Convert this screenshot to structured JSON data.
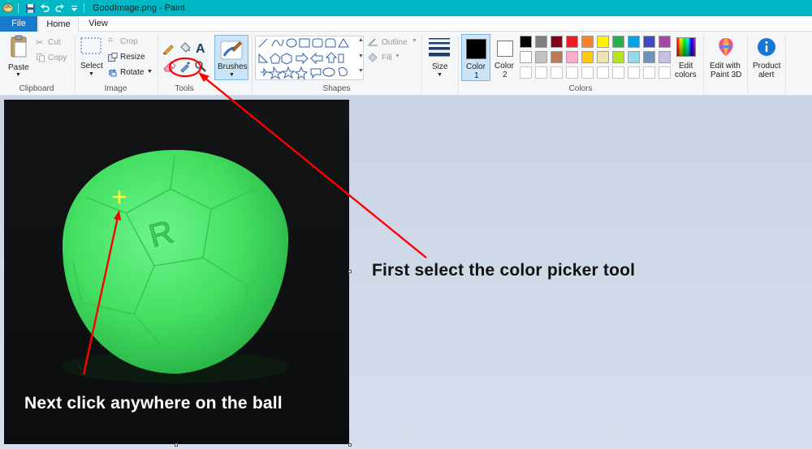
{
  "window": {
    "title": "GoodImage.png - Paint"
  },
  "tabs": {
    "file": "File",
    "home": "Home",
    "view": "View"
  },
  "clipboard": {
    "paste": "Paste",
    "cut": "Cut",
    "copy": "Copy",
    "label": "Clipboard"
  },
  "image": {
    "select": "Select",
    "crop": "Crop",
    "resize": "Resize",
    "rotate": "Rotate",
    "label": "Image"
  },
  "tools": {
    "label": "Tools"
  },
  "brushes": {
    "label": "Brushes"
  },
  "shapes": {
    "outline": "Outline",
    "fill": "Fill",
    "label": "Shapes"
  },
  "size": {
    "label": "Size"
  },
  "colors": {
    "color1_line1": "Color",
    "color1_line2": "1",
    "color2_line1": "Color",
    "color2_line2": "2",
    "edit_line1": "Edit",
    "edit_line2": "colors",
    "label": "Colors",
    "row1": [
      "#000000",
      "#7f7f7f",
      "#880015",
      "#ed1c24",
      "#ff7f27",
      "#fff200",
      "#22b14c",
      "#00a2e8",
      "#3f48cc",
      "#a349a4"
    ],
    "row2": [
      "#ffffff",
      "#c3c3c3",
      "#b97a57",
      "#ffaec9",
      "#ffc90e",
      "#efe4b0",
      "#b5e61d",
      "#99d9ea",
      "#7092be",
      "#c8bfe7"
    ],
    "row3": [
      "#ffffff",
      "#ffffff",
      "#ffffff",
      "#ffffff",
      "#ffffff",
      "#ffffff",
      "#ffffff",
      "#ffffff",
      "#ffffff",
      "#ffffff"
    ]
  },
  "paint3d": {
    "line1": "Edit with",
    "line2": "Paint 3D"
  },
  "alert": {
    "line1": "Product",
    "line2": "alert"
  },
  "annotations": {
    "first": "First select the color picker tool",
    "next": "Next click anywhere on the ball"
  },
  "accent": {
    "titlebar": "#00b7c3",
    "file_tab": "#1979ca",
    "arrow": "#ff0000",
    "ball": "#4ee86a"
  }
}
